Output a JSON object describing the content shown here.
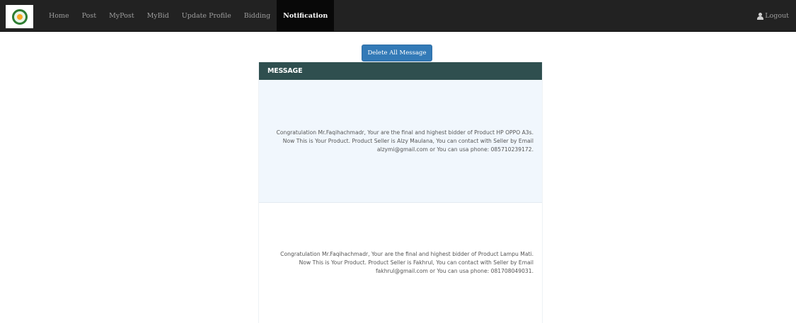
{
  "navbar": {
    "logo": "leaf-emblem-logo",
    "items": [
      {
        "label": "Home",
        "active": false
      },
      {
        "label": "Post",
        "active": false
      },
      {
        "label": "MyPost",
        "active": false
      },
      {
        "label": "MyBid",
        "active": false
      },
      {
        "label": "Update Profile",
        "active": false
      },
      {
        "label": "Bidding",
        "active": false
      },
      {
        "label": "Notification",
        "active": true
      }
    ],
    "logout_label": "Logout",
    "logout_icon": "user-icon"
  },
  "actions": {
    "delete_all_label": "Delete All Message"
  },
  "panel": {
    "title": "MESSAGE",
    "messages": [
      {
        "text": "Congratulation Mr.Faqihachmadr, Your are the final and highest bidder of Product HP OPPO A3s. Now This is Your Product. Product Seller is Alzy Maulana, You can contact with Seller by Email alzymi@gmail.com or You can usa phone: 085710239172."
      },
      {
        "text": "Congratulation Mr.Faqihachmadr, Your are the final and highest bidder of Product Lampu Mati. Now This is Your Product. Product Seller is Fakhrul, You can contact with Seller by Email fakhrul@gmail.com or You can usa phone: 081708049031."
      }
    ]
  },
  "colors": {
    "navbar_bg": "#222222",
    "active_nav_bg": "#080808",
    "button_primary": "#337ab7",
    "panel_header": "#2f4f4f",
    "message_highlight": "#f1f7fd"
  }
}
